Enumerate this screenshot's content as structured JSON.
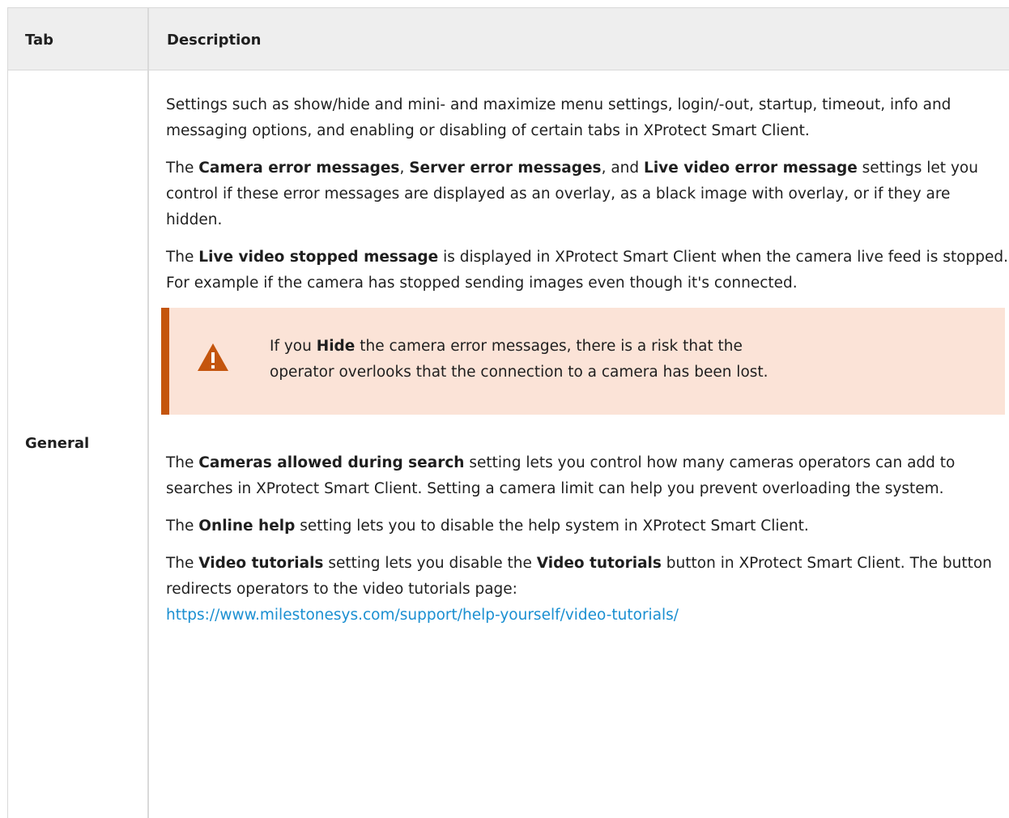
{
  "table": {
    "header": {
      "tab": "Tab",
      "description": "Description"
    },
    "row": {
      "tab": "General",
      "p1": "Settings such as show/hide and mini- and maximize menu settings, login/-out, startup, timeout, info and messaging options, and enabling or disabling of certain tabs in XProtect Smart Client.",
      "p2": {
        "t1": "The ",
        "b1": "Camera error messages",
        "t2": ", ",
        "b2": "Server error messages",
        "t3": ", and ",
        "b3": "Live video error message",
        "t4": " settings let you control if these error messages are displayed as an overlay, as a black image with overlay, or if they are hidden."
      },
      "p3": {
        "t1": "The ",
        "b1": "Live video stopped message",
        "t2": " is displayed in XProtect Smart Client when the camera live feed is stopped. For example if the camera has stopped sending images even though it's connected."
      },
      "warning": {
        "icon": "warning-triangle-icon",
        "t1": "If you ",
        "b1": "Hide",
        "t2": " the camera error messages, there is a risk that the",
        "line2": "operator overlooks that the connection to a camera has been lost."
      },
      "p4": {
        "t1": "The ",
        "b1": "Cameras allowed during search",
        "t2": " setting lets you control how many cameras operators can add to searches in XProtect Smart Client. Setting a camera limit can help you prevent overloading the system."
      },
      "p5": {
        "t1": "The ",
        "b1": "Online help",
        "t2": " setting lets you to disable the help system in XProtect Smart Client."
      },
      "p6": {
        "t1": "The ",
        "b1": "Video tutorials",
        "t2": " setting lets you disable the ",
        "b2": "Video tutorials",
        "t3": " button in XProtect Smart Client. The button redirects operators to the video tutorials page:",
        "link": "https://www.milestonesys.com/support/help-yourself/video-tutorials/"
      }
    }
  },
  "colors": {
    "header_bg": "#eeeeee",
    "border": "#d9d9d9",
    "warning_bg": "#fbe3d7",
    "warning_accent": "#c4550d",
    "link": "#1a8fd1"
  }
}
